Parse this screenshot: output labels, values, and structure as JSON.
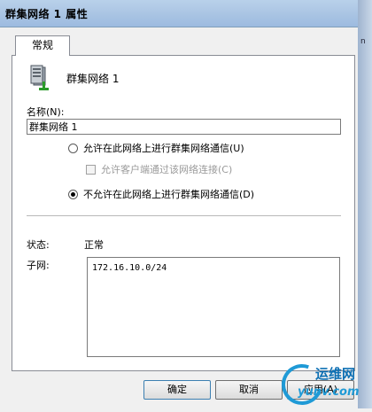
{
  "window": {
    "title": "群集网络 1 属性"
  },
  "tabs": [
    {
      "label": "常规",
      "selected": true
    }
  ],
  "general": {
    "network_name": "群集网络 1",
    "name_label": "名称(N):",
    "name_value": "群集网络 1",
    "option_allow": "允许在此网络上进行群集网络通信(U)",
    "option_allow_checked": false,
    "option_allow_clients": "允许客户端通过该网络连接(C)",
    "option_allow_clients_checked": false,
    "option_allow_clients_enabled": false,
    "option_deny": "不允许在此网络上进行群集网络通信(D)",
    "option_deny_checked": true,
    "status_label": "状态:",
    "status_value": "正常",
    "subnet_label": "子网:",
    "subnets": [
      "172.16.10.0/24"
    ]
  },
  "buttons": {
    "ok": "确定",
    "cancel": "取消",
    "apply": "应用(A)"
  },
  "icons": {
    "server": "server-network-icon",
    "watermark": "yunwei-logo"
  },
  "watermark": {
    "text_cn": "运维网",
    "text_en": "yunv.com"
  },
  "colors": {
    "titlebar": "#a9c4e3",
    "panel_bg": "#ffffff",
    "dialog_bg": "#f0f0f0",
    "watermark_blue": "#1f9ad6"
  }
}
